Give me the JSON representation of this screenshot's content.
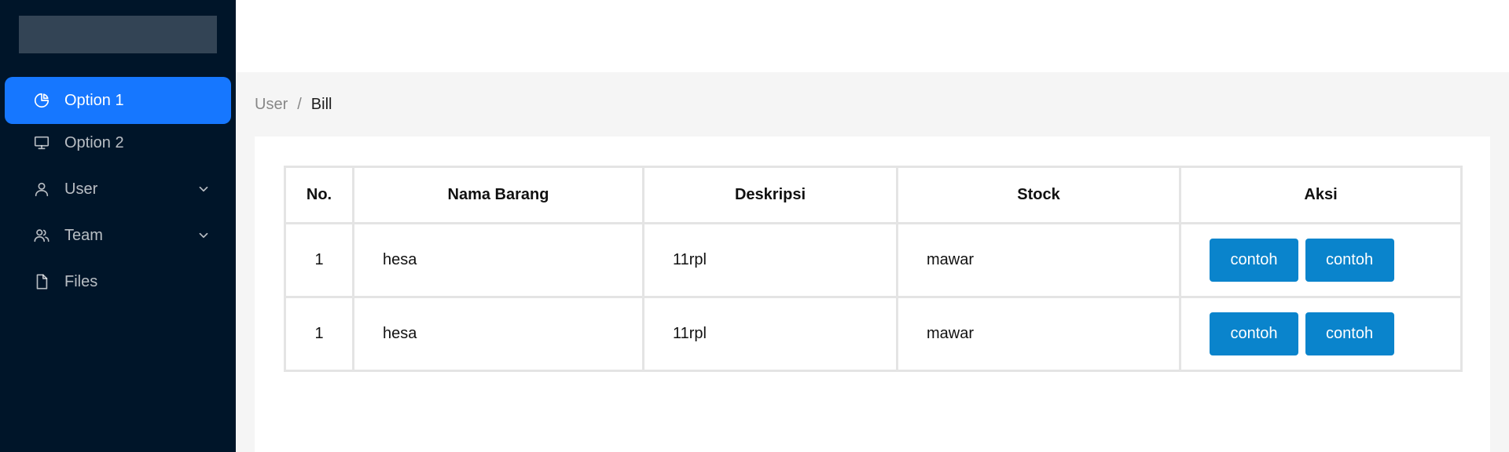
{
  "sidebar": {
    "items": [
      {
        "label": "Option 1",
        "icon": "pie-chart-icon",
        "active": true
      },
      {
        "label": "Option 2",
        "icon": "desktop-icon",
        "active": false
      },
      {
        "label": "User",
        "icon": "user-icon",
        "active": false,
        "has_submenu": true
      },
      {
        "label": "Team",
        "icon": "team-icon",
        "active": false,
        "has_submenu": true
      },
      {
        "label": "Files",
        "icon": "file-icon",
        "active": false
      }
    ]
  },
  "breadcrumb": {
    "items": [
      "User",
      "Bill"
    ],
    "separator": "/"
  },
  "table": {
    "headers": [
      "No.",
      "Nama Barang",
      "Deskripsi",
      "Stock",
      "Aksi"
    ],
    "rows": [
      {
        "no": "1",
        "nama": "hesa",
        "deskripsi": "11rpl",
        "stock": "mawar",
        "actions": [
          "contoh",
          "contoh"
        ]
      },
      {
        "no": "1",
        "nama": "hesa",
        "deskripsi": "11rpl",
        "stock": "mawar",
        "actions": [
          "contoh",
          "contoh"
        ]
      }
    ]
  },
  "colors": {
    "sider_bg": "#001529",
    "active_item": "#1677ff",
    "action_button": "#0a84cc"
  }
}
